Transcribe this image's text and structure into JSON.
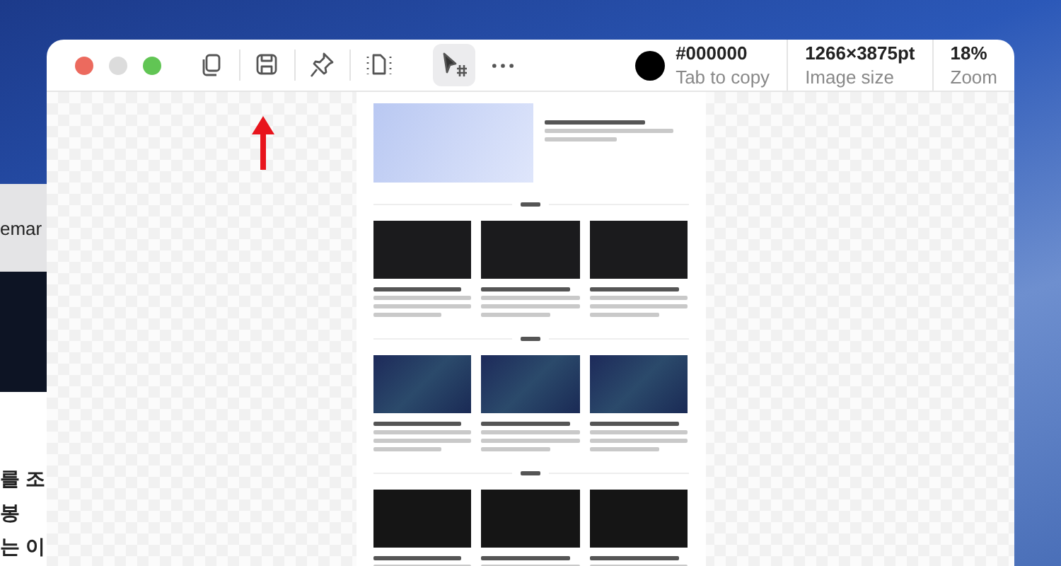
{
  "window": {
    "toolbar": {
      "tools": [
        {
          "kind": "copy",
          "selected": false
        },
        {
          "kind": "save",
          "selected": false
        },
        {
          "kind": "pin",
          "selected": false
        },
        {
          "kind": "frame",
          "selected": false
        },
        {
          "kind": "cursor",
          "selected": true
        },
        {
          "kind": "more",
          "selected": false
        }
      ],
      "picked_color": {
        "value": "#000000",
        "hint": "Tab to copy"
      },
      "stats": [
        {
          "value": "1266×3875pt",
          "label": "Image size"
        },
        {
          "value": "18%",
          "label": "Zoom"
        }
      ]
    }
  },
  "background_window": {
    "address_bar": "emar",
    "lines": [
      "를 조",
      "봉",
      "는 이"
    ]
  }
}
